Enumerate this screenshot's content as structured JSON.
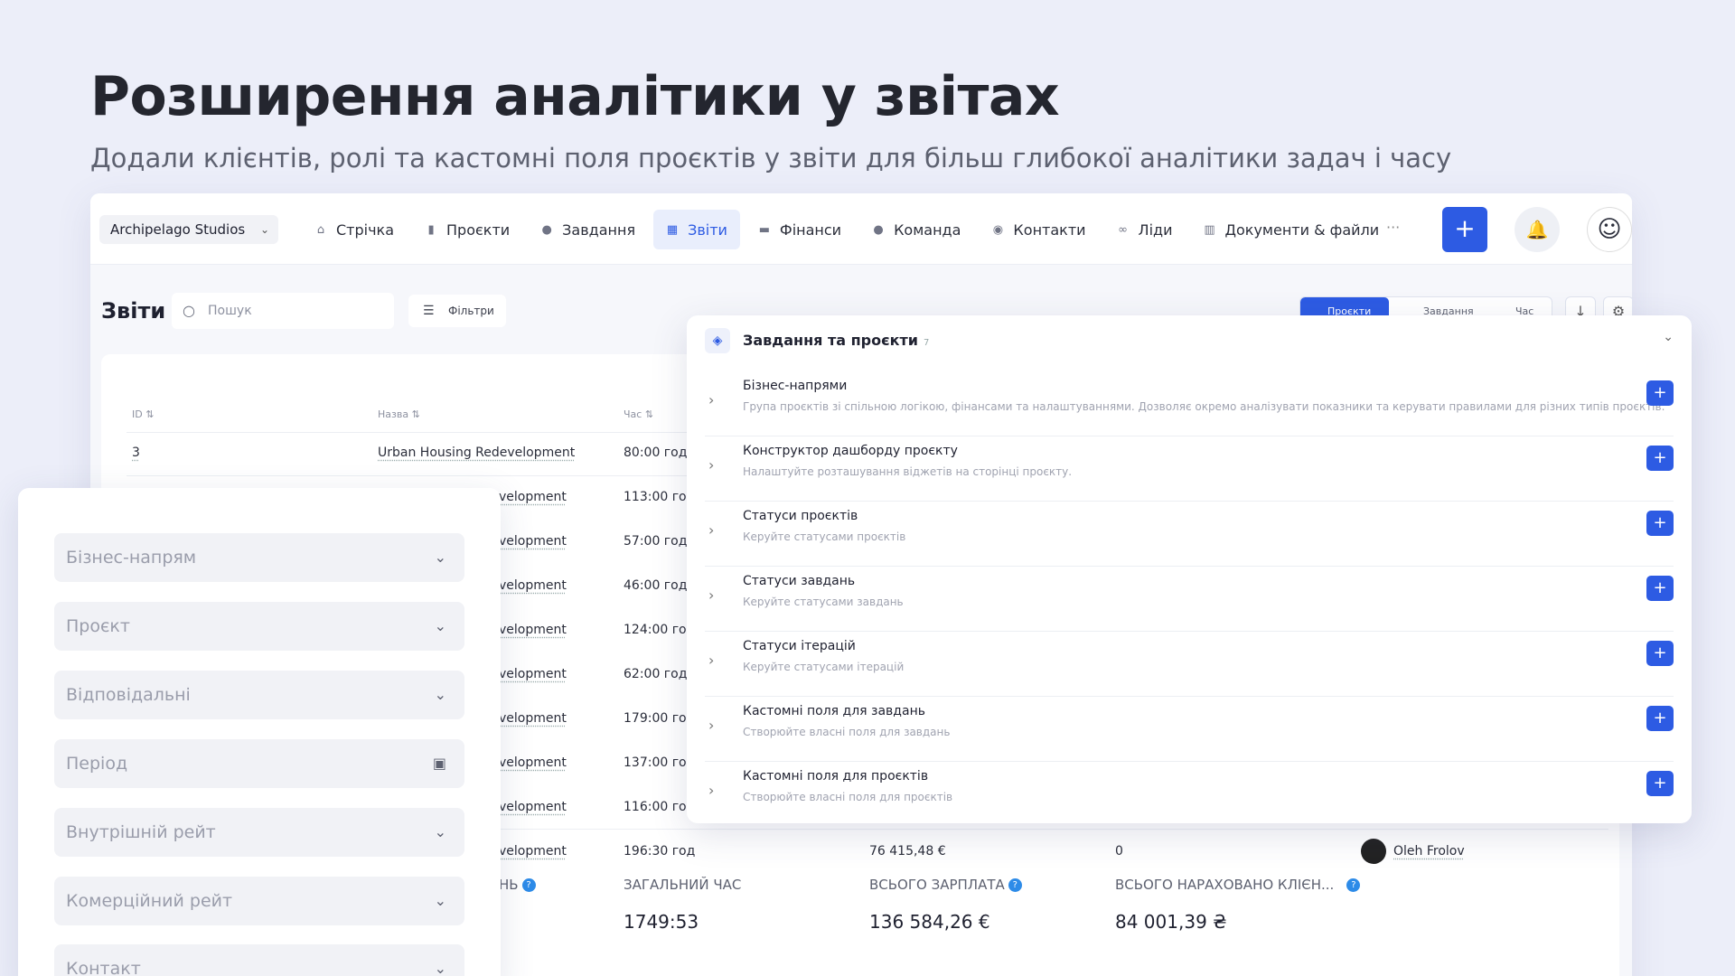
{
  "hero": {
    "title": "Розширення аналітики у звітах",
    "subtitle": "Додали клієнтів, ролі та кастомні поля проєктів у звіти для більш глибокої аналітики задач і часу"
  },
  "topbar": {
    "workspace": "Archipelago Studios",
    "nav": [
      {
        "label": "Стрічка",
        "icon": "home-icon"
      },
      {
        "label": "Проєкти",
        "icon": "document-icon"
      },
      {
        "label": "Завдання",
        "icon": "check-circle-icon"
      },
      {
        "label": "Звіти",
        "icon": "chart-icon",
        "active": true
      },
      {
        "label": "Фінанси",
        "icon": "wallet-icon"
      },
      {
        "label": "Команда",
        "icon": "user-icon"
      },
      {
        "label": "Контакти",
        "icon": "contact-icon"
      },
      {
        "label": "Ліди",
        "icon": "link-icon"
      },
      {
        "label": "Документи & файли",
        "icon": "book-icon"
      }
    ],
    "more": "···",
    "add": "+"
  },
  "toolbar": {
    "title": "Звіти",
    "search_placeholder": "Пошук",
    "filters": "Фільтри",
    "segments": [
      "Проєкти",
      "Завдання",
      "Час"
    ]
  },
  "table": {
    "headers": [
      "ID",
      "Назва",
      "Час"
    ],
    "rows": [
      {
        "id": "3",
        "name": "Urban Housing Redevelopment",
        "time": "80:00 год"
      },
      {
        "name": "velopment",
        "time": "113:00 год"
      },
      {
        "name": "velopment",
        "time": "57:00 год"
      },
      {
        "name": "velopment",
        "time": "46:00 год"
      },
      {
        "name": "velopment",
        "time": "124:00 год"
      },
      {
        "name": "velopment",
        "time": "62:00 год"
      },
      {
        "name": "velopment",
        "time": "179:00 год"
      },
      {
        "name": "velopment",
        "time": "137:00 год"
      },
      {
        "name": "velopment",
        "time": "116:00 год"
      },
      {
        "name": "velopment",
        "time": "196:30 год",
        "salary": "76 415,48 €",
        "client": "0",
        "user": "Oleh Frolov"
      }
    ],
    "totals": [
      {
        "label": "НЬ",
        "value": ""
      },
      {
        "label": "ЗАГАЛЬНИЙ ЧАС",
        "value": "1749:53"
      },
      {
        "label": "ВСЬОГО ЗАРПЛАТА",
        "value": "136 584,26 €"
      },
      {
        "label": "ВСЬОГО НАРАХОВАНО КЛІЄН...",
        "value": "84 001,39 ₴"
      }
    ],
    "help": "?"
  },
  "filter_panel": [
    {
      "label": "Бізнес-напрям",
      "kind": "select"
    },
    {
      "label": "Проєкт",
      "kind": "select"
    },
    {
      "label": "Відповідальні",
      "kind": "select"
    },
    {
      "label": "Період",
      "kind": "date"
    },
    {
      "label": "Внутрішній рейт",
      "kind": "select"
    },
    {
      "label": "Комерційний рейт",
      "kind": "select"
    },
    {
      "label": "Контакт",
      "kind": "select"
    }
  ],
  "settings_panel": {
    "title": "Завдання та проєкти",
    "count": "7",
    "rows": [
      {
        "name": "Бізнес-напрями",
        "desc": "Група проєктів зі спільною логікою, фінансами та налаштуваннями. Дозволяє окремо аналізувати показники та керувати правилами для різних типів проєктів."
      },
      {
        "name": "Конструктор дашборду проєкту",
        "desc": "Налаштуйте розташування віджетів на сторінці проєкту."
      },
      {
        "name": "Статуси проєктів",
        "desc": "Керуйте статусами проєктів"
      },
      {
        "name": "Статуси завдань",
        "desc": "Керуйте статусами завдань"
      },
      {
        "name": "Статуси ітерацій",
        "desc": "Керуйте статусами ітерацій"
      },
      {
        "name": "Кастомні поля для завдань",
        "desc": "Створюйте власні поля для завдань"
      },
      {
        "name": "Кастомні поля для проєктів",
        "desc": "Створюйте власні поля для проєктів"
      }
    ]
  },
  "colors": {
    "accent": "#2d5be3",
    "background": "#eceef9",
    "help": "#2d8be8"
  }
}
